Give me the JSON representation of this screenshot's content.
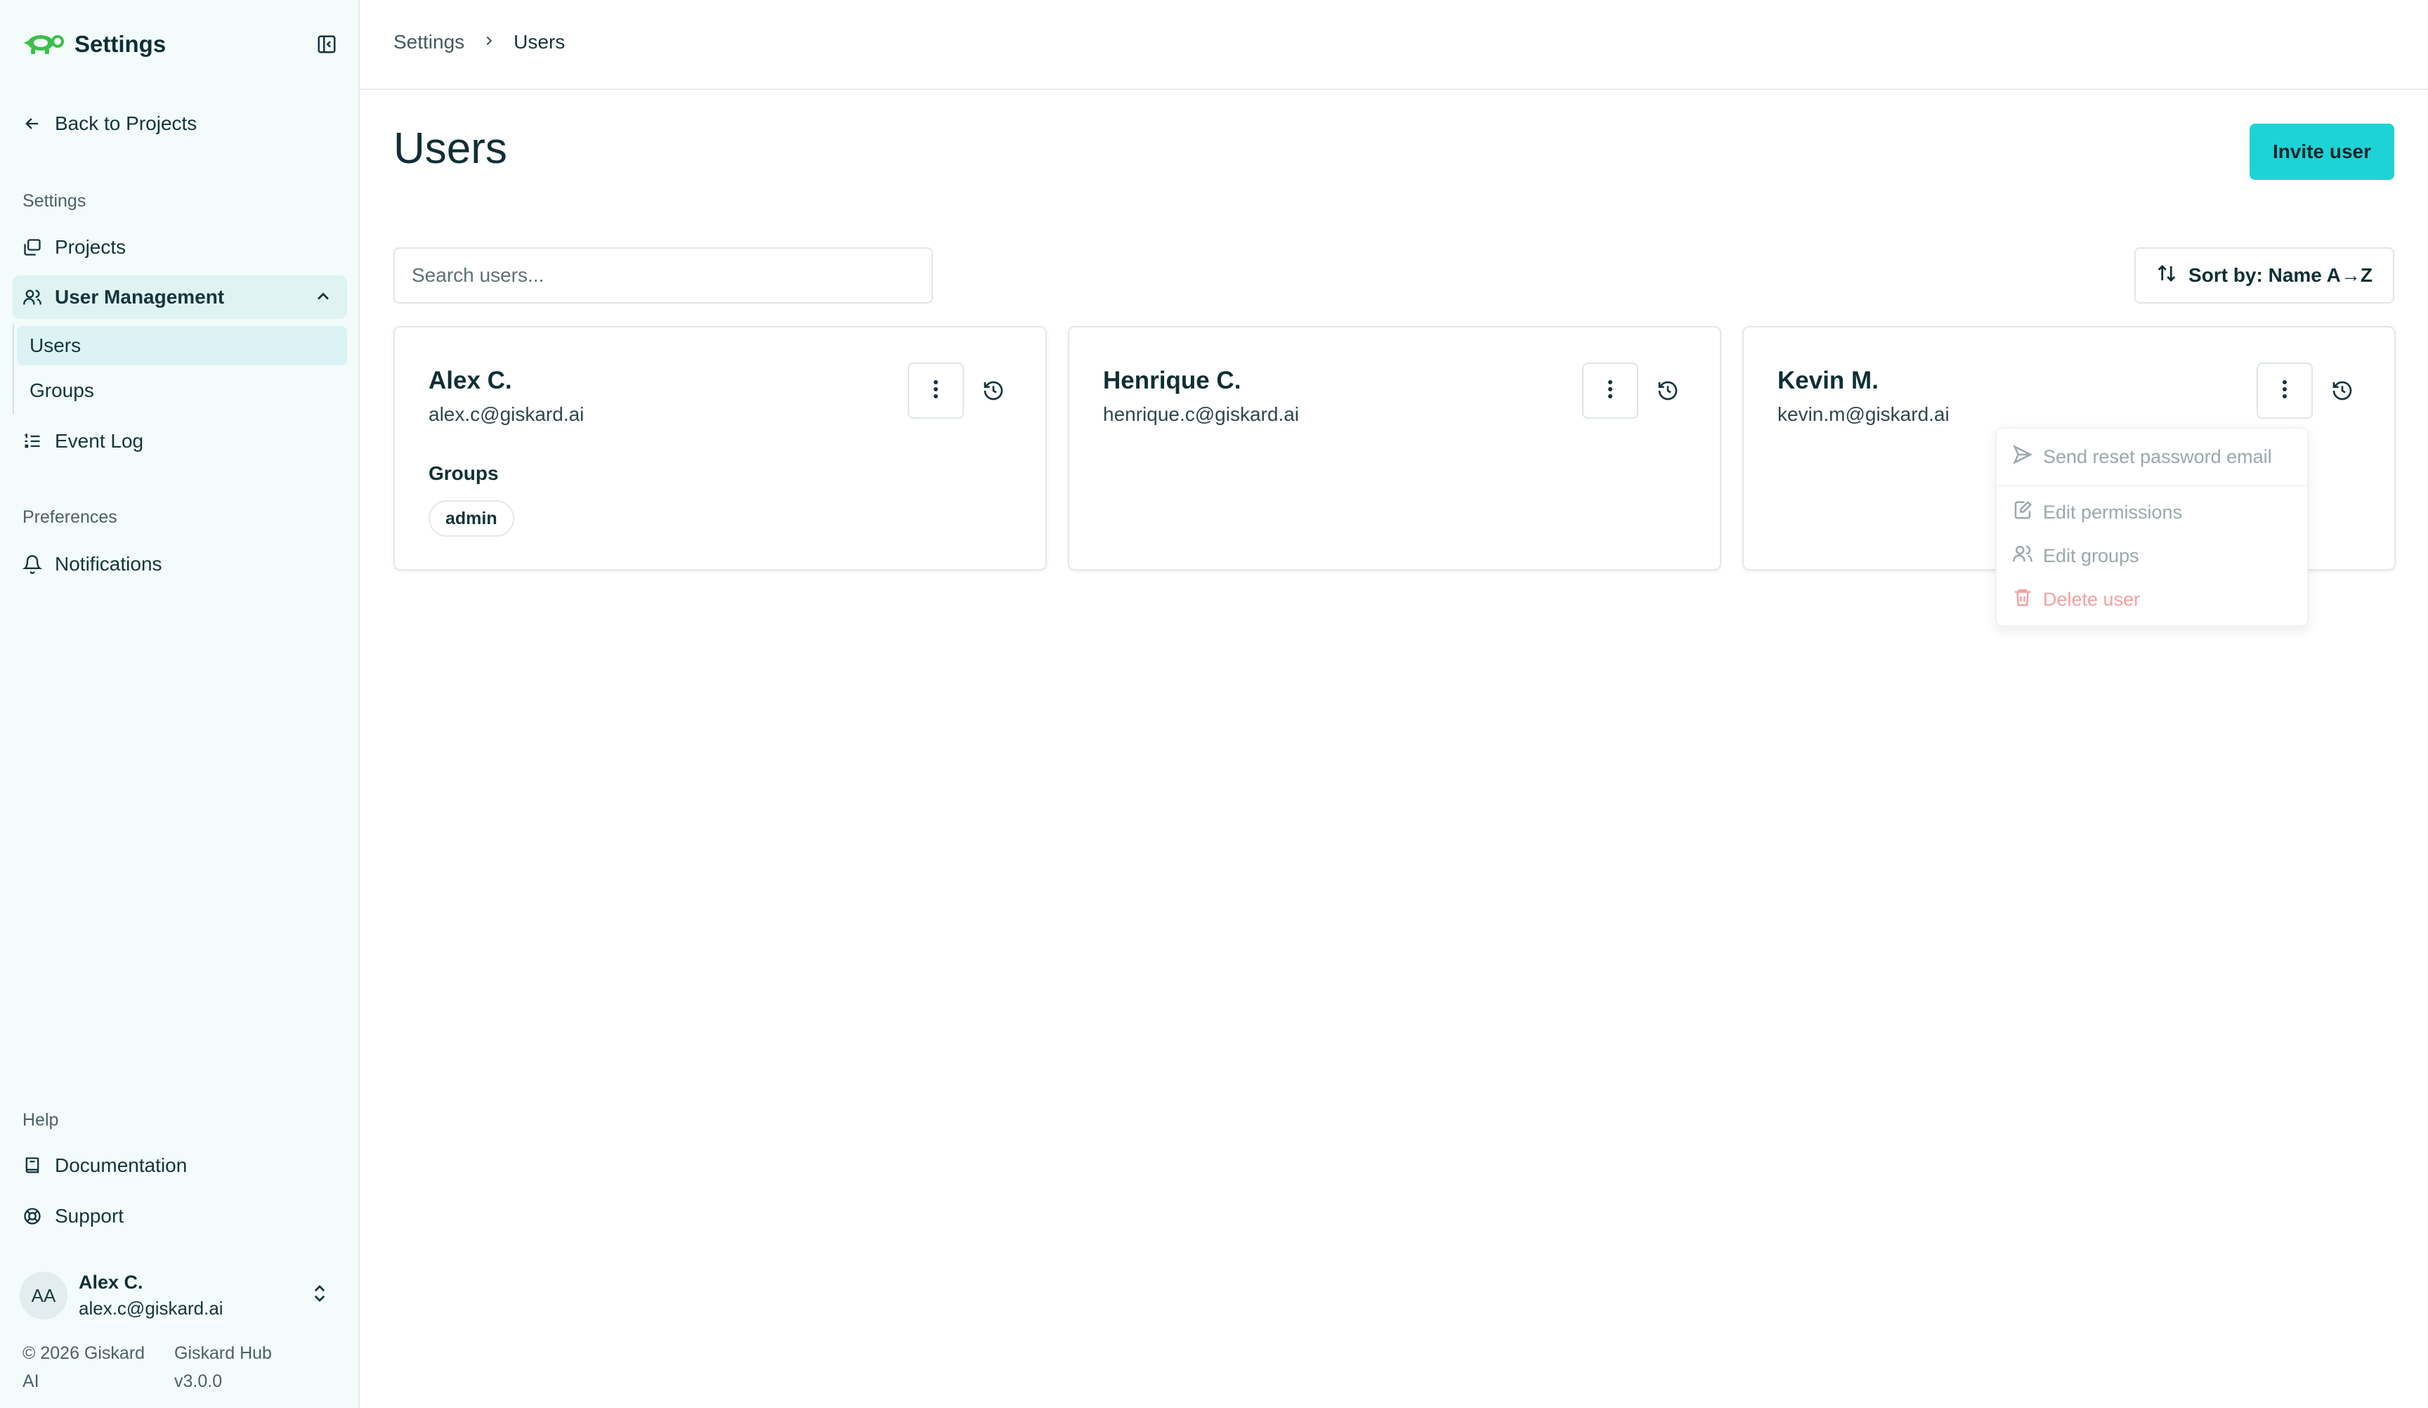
{
  "sidebar": {
    "brand_title": "Settings",
    "back_label": "Back to Projects",
    "settings_section": "Settings",
    "items": {
      "projects": "Projects",
      "user_management": "User Management",
      "users": "Users",
      "groups": "Groups",
      "event_log": "Event Log"
    },
    "preferences_section": "Preferences",
    "notifications": "Notifications",
    "help_section": "Help",
    "documentation": "Documentation",
    "support": "Support",
    "user": {
      "initials": "AA",
      "name": "Alex C.",
      "email": "alex.c@giskard.ai"
    },
    "footer": {
      "copyright_line1": "© 2026 Giskard",
      "copyright_line2": "AI",
      "product_line1": "Giskard Hub",
      "product_line2": "v3.0.0"
    }
  },
  "breadcrumb": {
    "parent": "Settings",
    "current": "Users"
  },
  "main": {
    "title": "Users",
    "invite_label": "Invite user",
    "search_placeholder": "Search users...",
    "sort_label": "Sort by: Name A→Z"
  },
  "users": [
    {
      "name": "Alex C.",
      "email": "alex.c@giskard.ai",
      "groups_label": "Groups",
      "groups": [
        "admin"
      ]
    },
    {
      "name": "Henrique C.",
      "email": "henrique.c@giskard.ai"
    },
    {
      "name": "Kevin M.",
      "email": "kevin.m@giskard.ai"
    }
  ],
  "menu": {
    "send_reset": "Send reset password email",
    "edit_permissions": "Edit permissions",
    "edit_groups": "Edit groups",
    "delete_user": "Delete user"
  },
  "colors": {
    "accent": "#1dd3d6",
    "sidebar_bg": "#f3fbfb",
    "active_bg": "#dff3f3",
    "brand_green": "#3bbf4a",
    "danger_muted": "#f3a0a0"
  },
  "icons": {
    "logo": "turtle-logo-icon",
    "collapse": "sidebar-collapse-icon",
    "back": "arrow-left-icon",
    "projects": "stack-icon",
    "users": "users-icon",
    "event_log": "list-icon",
    "notifications": "bell-icon",
    "documentation": "book-icon",
    "support": "lifebuoy-icon",
    "sort": "sort-icon",
    "kebab": "more-vertical-icon",
    "history": "history-icon",
    "send": "send-icon",
    "edit": "edit-icon",
    "trash": "trash-icon"
  }
}
